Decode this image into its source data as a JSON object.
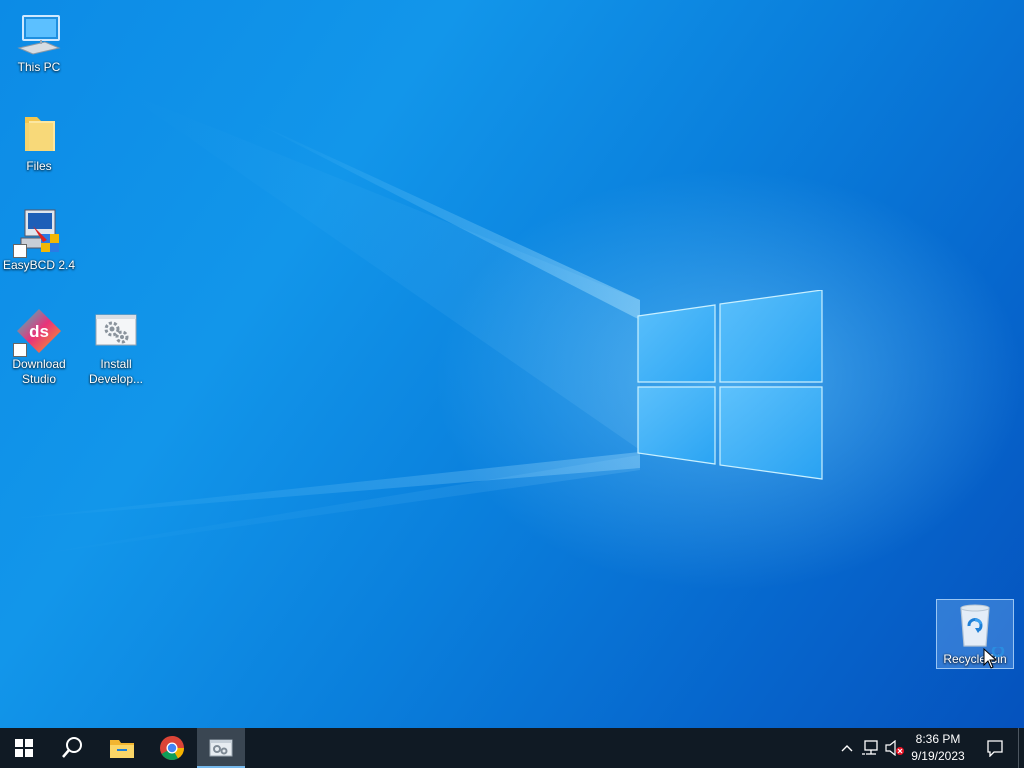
{
  "desktop": {
    "icons": [
      {
        "label": "This PC",
        "icon": "computer-icon"
      },
      {
        "label": "Files",
        "icon": "folder-icon"
      },
      {
        "label": "EasyBCD 2.4",
        "icon": "easybcd-icon"
      },
      {
        "label": "Download Studio",
        "icon": "download-studio-icon",
        "badge": "ds"
      },
      {
        "label": "Install Develop...",
        "icon": "settings-gears-icon"
      },
      {
        "label": "Recycle Bin",
        "icon": "recycle-bin-icon"
      }
    ],
    "accent_color": "#0a78d7"
  },
  "taskbar": {
    "items": [
      {
        "name": "start-button",
        "icon": "windows-logo-icon"
      },
      {
        "name": "search-button",
        "icon": "search-icon"
      },
      {
        "name": "file-explorer-button",
        "icon": "folder-icon"
      },
      {
        "name": "chrome-button",
        "icon": "chrome-icon"
      },
      {
        "name": "active-app-button",
        "icon": "app-window-icon",
        "active": true
      }
    ],
    "tray": {
      "time": "8:36 PM",
      "date": "9/19/2023"
    },
    "background": "#101a24"
  }
}
